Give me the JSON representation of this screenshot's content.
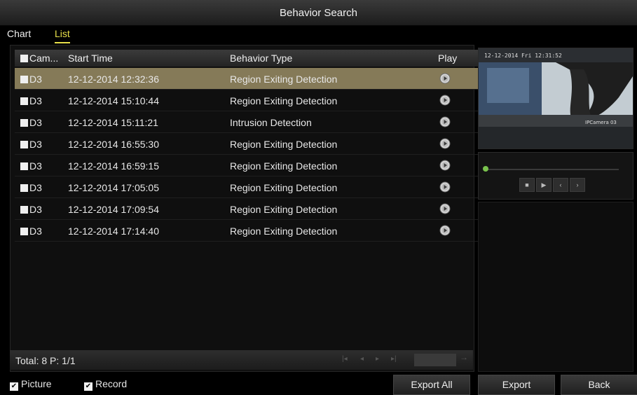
{
  "window": {
    "title": "Behavior Search"
  },
  "tabs": [
    {
      "label": "Chart",
      "active": false
    },
    {
      "label": "List",
      "active": true
    }
  ],
  "table": {
    "columns": [
      "Cam...",
      "Start Time",
      "Behavior Type",
      "Play"
    ],
    "rows": [
      {
        "camera": "D3",
        "start_time": "12-12-2014 12:32:36",
        "behavior": "Region Exiting Detection",
        "selected": true
      },
      {
        "camera": "D3",
        "start_time": "12-12-2014 15:10:44",
        "behavior": "Region Exiting Detection"
      },
      {
        "camera": "D3",
        "start_time": "12-12-2014 15:11:21",
        "behavior": "Intrusion Detection"
      },
      {
        "camera": "D3",
        "start_time": "12-12-2014 16:55:30",
        "behavior": "Region Exiting Detection"
      },
      {
        "camera": "D3",
        "start_time": "12-12-2014 16:59:15",
        "behavior": "Region Exiting Detection"
      },
      {
        "camera": "D3",
        "start_time": "12-12-2014 17:05:05",
        "behavior": "Region Exiting Detection"
      },
      {
        "camera": "D3",
        "start_time": "12-12-2014 17:09:54",
        "behavior": "Region Exiting Detection"
      },
      {
        "camera": "D3",
        "start_time": "12-12-2014 17:14:40",
        "behavior": "Region Exiting Detection"
      }
    ]
  },
  "footer": {
    "total": "Total: 8  P: 1/1"
  },
  "options": {
    "picture_label": "Picture",
    "record_label": "Record",
    "picture_checked": true,
    "record_checked": true
  },
  "buttons": {
    "export_all": "Export All",
    "export": "Export",
    "back": "Back"
  },
  "colors": {
    "selected_row": "#857a58",
    "active_tab": "#e8e04a",
    "progress": "#79c24d"
  },
  "icons": {
    "play": "play-icon",
    "stop": "stop-icon",
    "next": "next-icon",
    "prev": "prev-icon"
  }
}
